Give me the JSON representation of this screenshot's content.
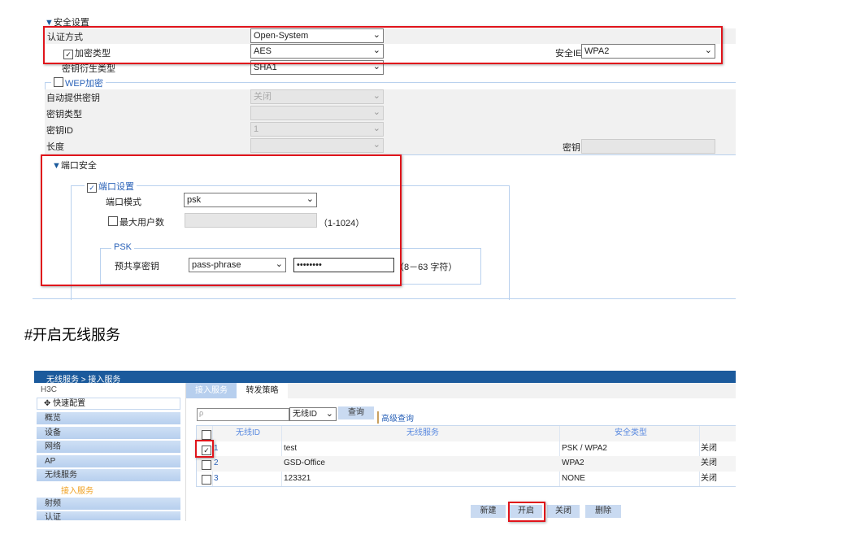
{
  "security_settings": {
    "section_title": "安全设置",
    "auth_method": {
      "label": "认证方式",
      "value": "Open-System"
    },
    "encryption_type": {
      "label": "加密类型",
      "checked": true,
      "value": "AES"
    },
    "key_derivation": {
      "label": "密钥衍生类型",
      "value": "SHA1"
    },
    "security_ie": {
      "label": "安全IE",
      "value": "WPA2"
    },
    "wep": {
      "legend": "WEP加密",
      "checked": false,
      "auto_key": {
        "label": "自动提供密钥",
        "value": "关闭"
      },
      "key_type": {
        "label": "密钥类型",
        "value": ""
      },
      "key_id": {
        "label": "密钥ID",
        "value": "1"
      },
      "length": {
        "label": "长度",
        "value": ""
      },
      "key": {
        "label": "密钥",
        "value": ""
      }
    }
  },
  "port_security": {
    "section_title": "端口安全",
    "port_settings": {
      "legend": "端口设置",
      "checked": true,
      "port_mode": {
        "label": "端口模式",
        "value": "psk"
      },
      "max_users": {
        "label": "最大用户数",
        "checked": false,
        "value": "",
        "hint": "（1-1024）"
      }
    },
    "psk": {
      "legend": "PSK",
      "preshared_key": {
        "label": "预共享密钥",
        "format": "pass-phrase",
        "value": "••••••••",
        "hint": "（8－63 字符）"
      }
    }
  },
  "heading": "#开启无线服务",
  "wireless_ui": {
    "breadcrumb": "无线服务 > 接入服务",
    "brand": "H3C",
    "sidebar": {
      "quick": "快速配置",
      "items": [
        "概览",
        "设备",
        "网络",
        "AP",
        "无线服务"
      ],
      "sub_active": "接入服务",
      "items2": [
        "射频",
        "认证"
      ]
    },
    "tabs": [
      "接入服务",
      "转发策略"
    ],
    "search": {
      "placeholder": "",
      "field": "无线ID",
      "query_btn": "查询",
      "advanced": "高级查询"
    },
    "table": {
      "headers": [
        "无线ID",
        "无线服务",
        "安全类型",
        ""
      ],
      "rows": [
        {
          "checked": true,
          "id": "1",
          "service": "test",
          "security": "PSK / WPA2",
          "status": "关闭"
        },
        {
          "checked": false,
          "id": "2",
          "service": "GSD-Office",
          "security": "WPA2",
          "status": "关闭"
        },
        {
          "checked": false,
          "id": "3",
          "service": "123321",
          "security": "NONE",
          "status": "关闭"
        }
      ]
    },
    "buttons": {
      "new": "新建",
      "enable": "开启",
      "disable": "关闭",
      "delete": "删除"
    }
  }
}
